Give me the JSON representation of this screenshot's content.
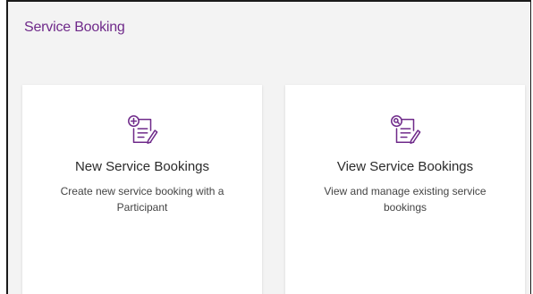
{
  "page": {
    "title": "Service Booking"
  },
  "cards": [
    {
      "icon": "document-add-icon",
      "title": "New Service Bookings",
      "description": "Create new service booking with a Participant"
    },
    {
      "icon": "document-search-icon",
      "title": "View Service Bookings",
      "description": "View and manage existing service bookings"
    }
  ],
  "colors": {
    "accent": "#6f2a8a",
    "background": "#f3f3f3",
    "card": "#ffffff",
    "text": "#2b2b2b"
  }
}
